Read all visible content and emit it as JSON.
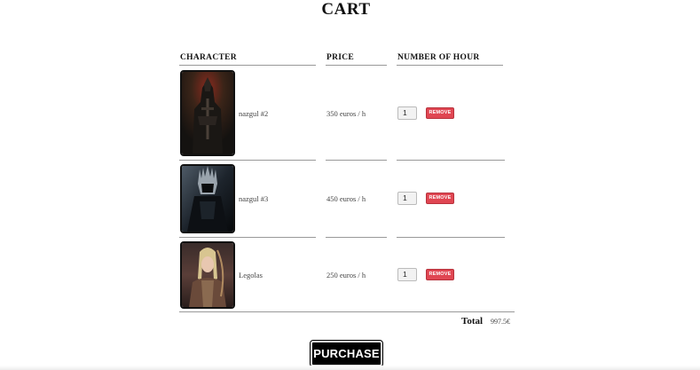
{
  "page": {
    "title": "CART"
  },
  "table": {
    "headers": [
      "CHARACTER",
      "PRICE",
      "NUMBER OF HOUR"
    ],
    "rows": [
      {
        "name": "nazgul #2",
        "price": "350 euros / h",
        "hours": "1",
        "remove_label": "REMOVE",
        "image": "nazgul-portrait"
      },
      {
        "name": "nazgul #3",
        "price": "450 euros / h",
        "hours": "1",
        "remove_label": "REMOVE",
        "image": "witch-king-portrait"
      },
      {
        "name": "Legolas",
        "price": "250 euros / h",
        "hours": "1",
        "remove_label": "REMOVE",
        "image": "legolas-portrait"
      }
    ]
  },
  "total": {
    "label": "Total",
    "value": "997.5€"
  },
  "actions": {
    "purchase_label": "PURCHASE"
  },
  "colors": {
    "remove_button": "#e04652",
    "purchase_button": "#000000"
  }
}
